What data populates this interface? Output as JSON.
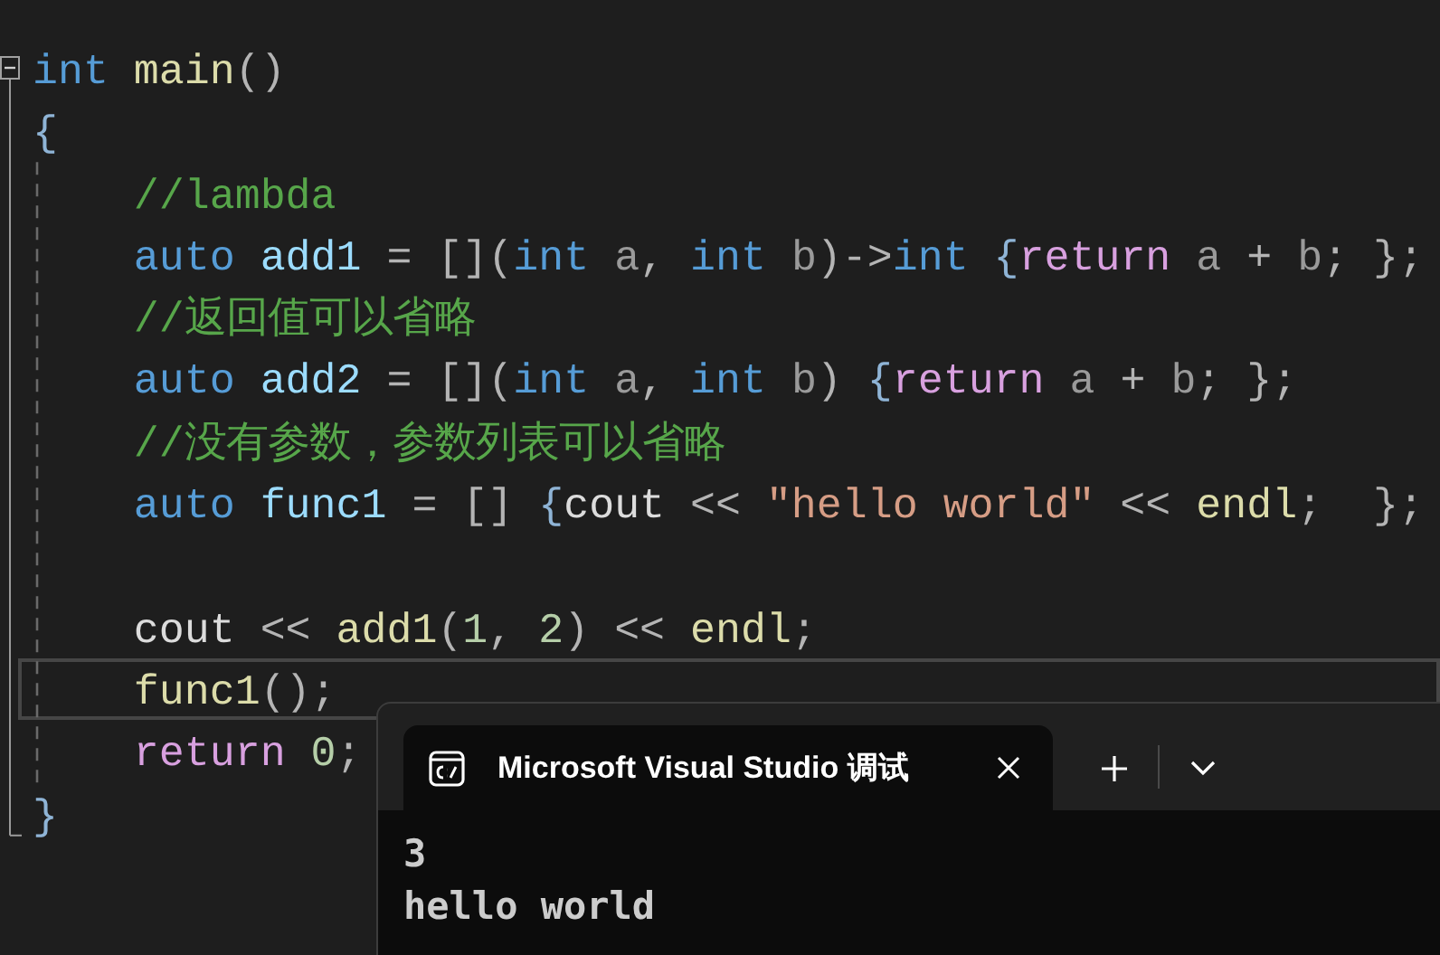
{
  "editor": {
    "fold_expanded": true,
    "lines": [
      {
        "current": false,
        "tokens": [
          {
            "kind": "kw",
            "text": "int "
          },
          {
            "kind": "fn",
            "text": "main"
          },
          {
            "kind": "pl",
            "text": "()"
          }
        ]
      },
      {
        "current": false,
        "tokens": [
          {
            "kind": "brace",
            "text": "{"
          }
        ]
      },
      {
        "current": false,
        "tokens": [
          {
            "kind": "cm",
            "text": "    //lambda"
          }
        ]
      },
      {
        "current": false,
        "tokens": [
          {
            "kind": "kw",
            "text": "    auto "
          },
          {
            "kind": "var",
            "text": "add1"
          },
          {
            "kind": "pl",
            "text": " = []("
          },
          {
            "kind": "kw",
            "text": "int "
          },
          {
            "kind": "par",
            "text": "a"
          },
          {
            "kind": "pl",
            "text": ", "
          },
          {
            "kind": "kw",
            "text": "int "
          },
          {
            "kind": "par",
            "text": "b"
          },
          {
            "kind": "pl",
            "text": ")->"
          },
          {
            "kind": "kw",
            "text": "int "
          },
          {
            "kind": "brace",
            "text": "{"
          },
          {
            "kind": "ctl",
            "text": "return "
          },
          {
            "kind": "par",
            "text": "a"
          },
          {
            "kind": "pl",
            "text": " + "
          },
          {
            "kind": "par",
            "text": "b"
          },
          {
            "kind": "pl",
            "text": "; };"
          }
        ]
      },
      {
        "current": false,
        "tokens": [
          {
            "kind": "cm",
            "text": "    //返回值可以省略"
          }
        ]
      },
      {
        "current": false,
        "tokens": [
          {
            "kind": "kw",
            "text": "    auto "
          },
          {
            "kind": "var",
            "text": "add2"
          },
          {
            "kind": "pl",
            "text": " = []("
          },
          {
            "kind": "kw",
            "text": "int "
          },
          {
            "kind": "par",
            "text": "a"
          },
          {
            "kind": "pl",
            "text": ", "
          },
          {
            "kind": "kw",
            "text": "int "
          },
          {
            "kind": "par",
            "text": "b"
          },
          {
            "kind": "pl",
            "text": ") "
          },
          {
            "kind": "brace",
            "text": "{"
          },
          {
            "kind": "ctl",
            "text": "return "
          },
          {
            "kind": "par",
            "text": "a"
          },
          {
            "kind": "pl",
            "text": " + "
          },
          {
            "kind": "par",
            "text": "b"
          },
          {
            "kind": "pl",
            "text": "; };"
          }
        ]
      },
      {
        "current": false,
        "tokens": [
          {
            "kind": "cm",
            "text": "    //没有参数，参数列表可以省略"
          }
        ]
      },
      {
        "current": false,
        "tokens": [
          {
            "kind": "kw",
            "text": "    auto "
          },
          {
            "kind": "var",
            "text": "func1"
          },
          {
            "kind": "pl",
            "text": " = [] "
          },
          {
            "kind": "brace",
            "text": "{"
          },
          {
            "kind": "obj",
            "text": "cout"
          },
          {
            "kind": "pl",
            "text": " << "
          },
          {
            "kind": "str",
            "text": "\"hello world\""
          },
          {
            "kind": "pl",
            "text": " << "
          },
          {
            "kind": "fn",
            "text": "endl"
          },
          {
            "kind": "pl",
            "text": ";  };"
          }
        ]
      },
      {
        "current": false
      },
      {
        "current": false,
        "tokens": [
          {
            "kind": "obj",
            "text": "    cout"
          },
          {
            "kind": "pl",
            "text": " << "
          },
          {
            "kind": "fn",
            "text": "add1"
          },
          {
            "kind": "pl",
            "text": "("
          },
          {
            "kind": "num",
            "text": "1"
          },
          {
            "kind": "pl",
            "text": ", "
          },
          {
            "kind": "num",
            "text": "2"
          },
          {
            "kind": "pl",
            "text": ") << "
          },
          {
            "kind": "fn",
            "text": "endl"
          },
          {
            "kind": "pl",
            "text": ";"
          }
        ]
      },
      {
        "current": true,
        "tokens": [
          {
            "kind": "fn",
            "text": "    func1"
          },
          {
            "kind": "pl",
            "text": "();"
          }
        ]
      },
      {
        "current": false,
        "tokens": [
          {
            "kind": "ctl",
            "text": "    return "
          },
          {
            "kind": "num",
            "text": "0"
          },
          {
            "kind": "pl",
            "text": ";"
          }
        ]
      },
      {
        "current": false,
        "tokens": [
          {
            "kind": "brace",
            "text": "}"
          }
        ]
      }
    ]
  },
  "terminal": {
    "tabs": [
      {
        "title": "Microsoft Visual Studio 调试",
        "selected": true
      }
    ],
    "output": [
      "3",
      "hello world"
    ]
  }
}
